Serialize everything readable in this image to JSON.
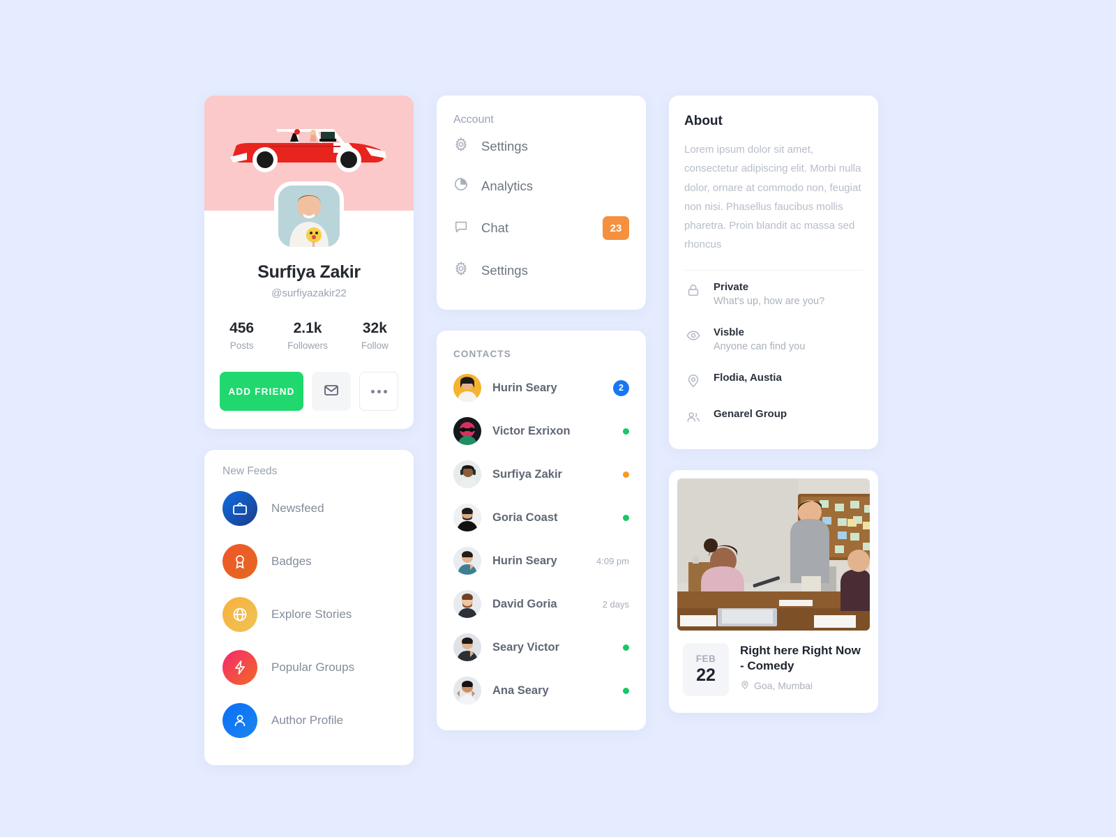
{
  "theme": {
    "page_background": "#e6ecff",
    "card_background": "#ffffff",
    "accent_green": "#20d86e",
    "accent_orange": "#f5903e",
    "accent_blue": "#1877f2",
    "cover_pink": "#fbc9c9"
  },
  "profile": {
    "name": "Surfiya Zakir",
    "handle": "@surfiyazakir22",
    "cover_illustration": "red-car-illustration",
    "avatar": "man-with-lollipop-photo",
    "stats": [
      {
        "value": "456",
        "label": "Posts"
      },
      {
        "value": "2.1k",
        "label": "Followers"
      },
      {
        "value": "32k",
        "label": "Follow"
      }
    ],
    "actions": {
      "primary_label": "ADD FRIEND",
      "message_icon": "envelope-icon",
      "more_icon": "more-dots-icon"
    }
  },
  "feeds": {
    "title": "New Feeds",
    "items": [
      {
        "label": "Newsfeed",
        "icon": "tv-icon",
        "color_from": "#0e6fe0",
        "color_to": "#1c3b8c"
      },
      {
        "label": "Badges",
        "icon": "award-icon",
        "color_from": "#f0562b",
        "color_to": "#e3691f"
      },
      {
        "label": "Explore Stories",
        "icon": "globe-icon",
        "color_from": "#f8b03e",
        "color_to": "#edc455"
      },
      {
        "label": "Popular Groups",
        "icon": "bolt-icon",
        "color_from": "#f5286f",
        "color_to": "#f26a23"
      },
      {
        "label": "Author Profile",
        "icon": "user-icon",
        "color_from": "#0b6ef5",
        "color_to": "#1a86f0"
      }
    ]
  },
  "account": {
    "title": "Account",
    "items": [
      {
        "label": "Settings",
        "icon": "gear-icon",
        "badge": ""
      },
      {
        "label": "Analytics",
        "icon": "pie-chart-icon",
        "badge": ""
      },
      {
        "label": "Chat",
        "icon": "chat-icon",
        "badge": "23"
      },
      {
        "label": "Settings",
        "icon": "gear-icon",
        "badge": ""
      }
    ]
  },
  "contacts": {
    "title": "CONTACTS",
    "items": [
      {
        "name": "Hurin Seary",
        "meta": "",
        "badge": "2",
        "status": "",
        "avatar": "woman-yellow-bg"
      },
      {
        "name": "Victor Exrixon",
        "meta": "",
        "badge": "",
        "status": "#17c964",
        "avatar": "man-neon-sunglasses"
      },
      {
        "name": "Surfiya Zakir",
        "meta": "",
        "badge": "",
        "status": "#f59b26",
        "avatar": "man-headphones"
      },
      {
        "name": "Goria Coast",
        "meta": "",
        "badge": "",
        "status": "#17c964",
        "avatar": "man-beard-black-shirt"
      },
      {
        "name": "Hurin Seary",
        "meta": "4:09 pm",
        "badge": "",
        "status": "",
        "avatar": "man-teal-shirt"
      },
      {
        "name": "David Goria",
        "meta": "2 days",
        "badge": "",
        "status": "",
        "avatar": "man-ginger-beard"
      },
      {
        "name": "Seary Victor",
        "meta": "",
        "badge": "",
        "status": "#17c964",
        "avatar": "man-dark-jacket"
      },
      {
        "name": "Ana Seary",
        "meta": "",
        "badge": "",
        "status": "#17c964",
        "avatar": "man-white-tank"
      }
    ]
  },
  "about": {
    "title": "About",
    "description": "Lorem ipsum dolor sit amet, consectetur adipiscing elit. Morbi nulla dolor, ornare at commodo non, feugiat non nisi. Phasellus faucibus mollis pharetra. Proin blandit ac massa sed rhoncus",
    "rows": [
      {
        "icon": "lock-icon",
        "title": "Private",
        "subtitle": "What's up, how are you?"
      },
      {
        "icon": "eye-icon",
        "title": "Visble",
        "subtitle": "Anyone can find you"
      },
      {
        "icon": "location-icon",
        "title": "Flodia, Austia",
        "subtitle": ""
      },
      {
        "icon": "users-icon",
        "title": "Genarel Group",
        "subtitle": ""
      }
    ]
  },
  "event": {
    "image": "office-meeting-photo",
    "month": "FEB",
    "day": "22",
    "title": "Right here Right Now - Comedy",
    "location": "Goa, Mumbai",
    "location_icon": "location-pin-icon"
  }
}
